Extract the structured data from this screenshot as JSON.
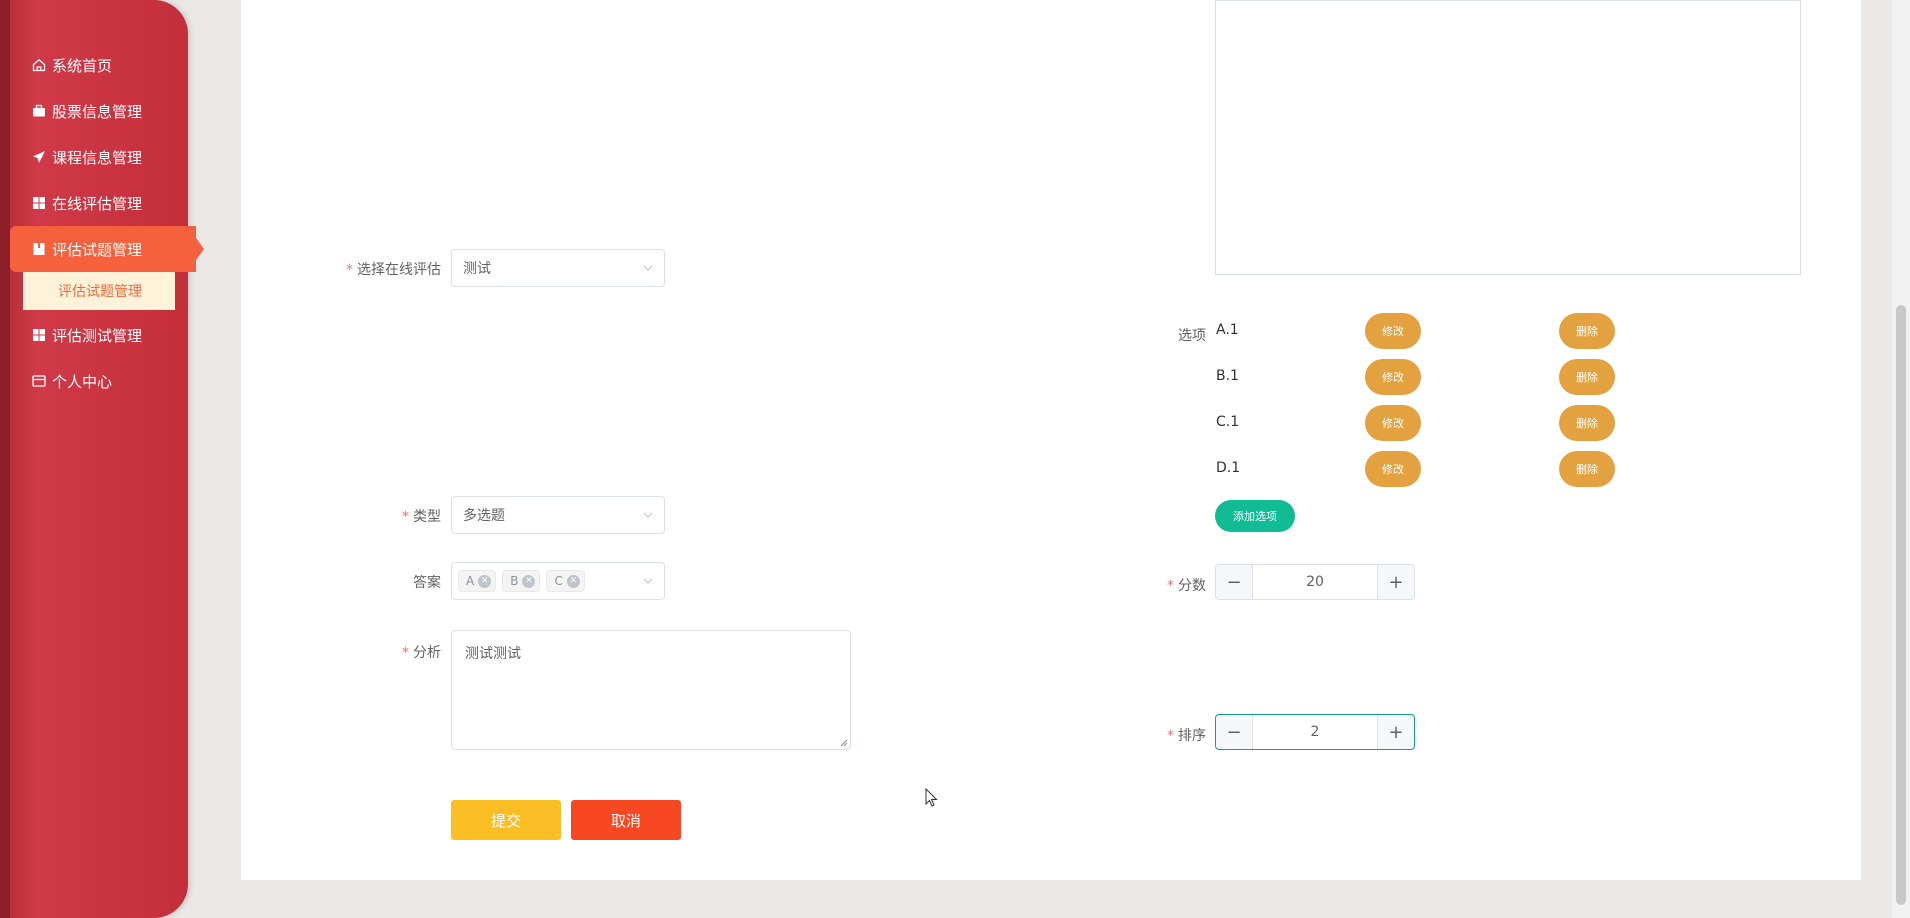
{
  "sidebar": {
    "items": [
      {
        "label": "系统首页",
        "icon": "home-icon"
      },
      {
        "label": "股票信息管理",
        "icon": "briefcase-icon"
      },
      {
        "label": "课程信息管理",
        "icon": "send-icon"
      },
      {
        "label": "在线评估管理",
        "icon": "grid-icon"
      },
      {
        "label": "评估试题管理",
        "icon": "book-icon",
        "active": true
      },
      {
        "label": "评估测试管理",
        "icon": "grid-icon"
      },
      {
        "label": "个人中心",
        "icon": "wallet-icon"
      }
    ],
    "submenu": {
      "label": "评估试题管理"
    }
  },
  "form": {
    "assessment": {
      "label": "选择在线评估",
      "value": "测试"
    },
    "type": {
      "label": "类型",
      "value": "多选题"
    },
    "answer": {
      "label": "答案",
      "tags": [
        "A",
        "B",
        "C"
      ]
    },
    "analysis": {
      "label": "分析",
      "value": "测试测试"
    },
    "options": {
      "label": "选项",
      "items": [
        {
          "text": "A.1"
        },
        {
          "text": "B.1"
        },
        {
          "text": "C.1"
        },
        {
          "text": "D.1"
        }
      ],
      "edit_label": "修改",
      "delete_label": "删除",
      "add_label": "添加选项"
    },
    "score": {
      "label": "分数",
      "value": "20"
    },
    "order": {
      "label": "排序",
      "value": "2"
    },
    "submit_label": "提交",
    "cancel_label": "取消"
  },
  "colors": {
    "sidebar": "#c42d3a",
    "active_menu": "#f5603d",
    "submenu_bg": "#fef3d9",
    "pill": "#e3a23f",
    "add_option": "#11bb94",
    "submit": "#fbbe24",
    "cancel": "#f74723"
  }
}
